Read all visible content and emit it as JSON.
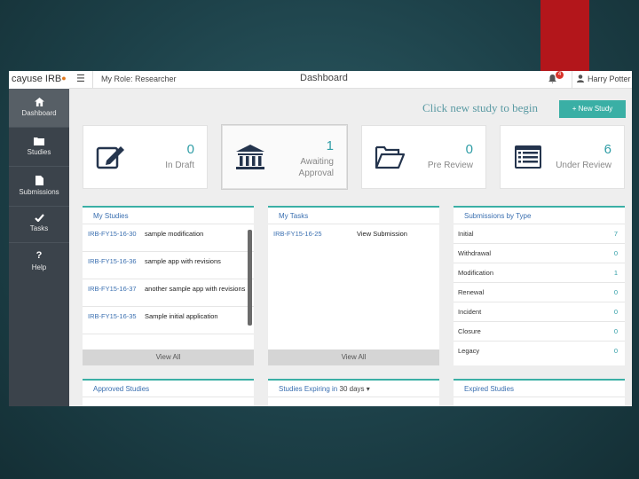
{
  "app": {
    "logo": "cayuse IRB",
    "logo_mark": "●"
  },
  "colors": {
    "accent": "#3aafa5",
    "link": "#3a6fb0",
    "sidebar": "#3b434b",
    "red_bar": "#b3161b"
  },
  "sidebar": {
    "items": [
      {
        "label": "Dashboard",
        "icon": "home-icon"
      },
      {
        "label": "Studies",
        "icon": "folder-icon"
      },
      {
        "label": "Submissions",
        "icon": "file-icon"
      },
      {
        "label": "Tasks",
        "icon": "check-icon"
      },
      {
        "label": "Help",
        "icon": "question-icon"
      }
    ]
  },
  "topbar": {
    "menu_icon": "☰",
    "role": "My Role: Researcher",
    "title": "Dashboard",
    "notification_count": "4",
    "user_name": "Harry Potter"
  },
  "hint": "Click new study to begin",
  "new_study_button": "+ New Study",
  "stats": [
    {
      "count": "0",
      "label": "In Draft",
      "icon": "pencil-icon"
    },
    {
      "count": "1",
      "label": "Awaiting Approval",
      "icon": "institution-icon"
    },
    {
      "count": "0",
      "label": "Pre Review",
      "icon": "open-folder-icon"
    },
    {
      "count": "6",
      "label": "Under Review",
      "icon": "list-icon"
    }
  ],
  "my_studies": {
    "title": "My Studies",
    "rows": [
      {
        "id": "IRB-FY15-16-30",
        "title": "sample modification"
      },
      {
        "id": "IRB-FY15-16-36",
        "title": "sample app with revisions"
      },
      {
        "id": "IRB-FY15-16-37",
        "title": "another sample app with revisions"
      },
      {
        "id": "IRB-FY15-16-35",
        "title": "Sample initial application"
      }
    ],
    "view_all": "View All"
  },
  "my_tasks": {
    "title": "My Tasks",
    "rows": [
      {
        "id": "IRB-FY15-16-25",
        "title": "View Submission"
      }
    ],
    "view_all": "View All"
  },
  "submissions_by_type": {
    "title": "Submissions by Type",
    "rows": [
      {
        "type": "Initial",
        "count": "7"
      },
      {
        "type": "Withdrawal",
        "count": "0"
      },
      {
        "type": "Modification",
        "count": "1"
      },
      {
        "type": "Renewal",
        "count": "0"
      },
      {
        "type": "Incident",
        "count": "0"
      },
      {
        "type": "Closure",
        "count": "0"
      },
      {
        "type": "Legacy",
        "count": "0"
      }
    ]
  },
  "approved_studies": {
    "title": "Approved Studies"
  },
  "expiring_studies": {
    "title": "Studies Expiring in",
    "days": "30 days",
    "caret": "▾"
  },
  "expired_studies": {
    "title": "Expired Studies"
  }
}
